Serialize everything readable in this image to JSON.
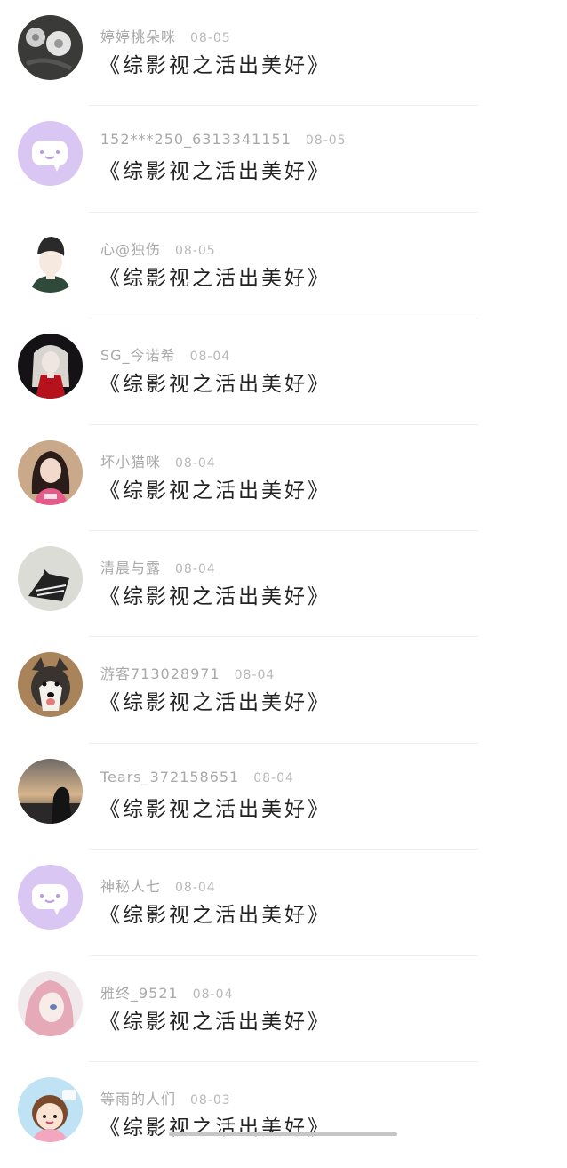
{
  "comments": [
    {
      "user": "婷婷桃朵咪",
      "date": "08-05",
      "text": "《综影视之活出美好》",
      "avatar": "flower-photo-avatar"
    },
    {
      "user": "152***250_6313341151",
      "date": "08-05",
      "text": "《综影视之活出美好》",
      "avatar": "default-chat-bubble-avatar"
    },
    {
      "user": "心@独伤",
      "date": "08-05",
      "text": "《综影视之活出美好》",
      "avatar": "anime-boy-avatar"
    },
    {
      "user": "SG_今诺希",
      "date": "08-04",
      "text": "《综影视之活出美好》",
      "avatar": "red-dress-doll-avatar"
    },
    {
      "user": "坏小猫咪",
      "date": "08-04",
      "text": "《综影视之活出美好》",
      "avatar": "girl-photo-avatar"
    },
    {
      "user": "清晨与露",
      "date": "08-04",
      "text": "《综影视之活出美好》",
      "avatar": "cat-photo-avatar"
    },
    {
      "user": "游客713028971",
      "date": "08-04",
      "text": "《综影视之活出美好》",
      "avatar": "husky-dog-avatar"
    },
    {
      "user": "Tears_372158651",
      "date": "08-04",
      "text": "《综影视之活出美好》",
      "avatar": "sunset-silhouette-avatar"
    },
    {
      "user": "神秘人七",
      "date": "08-04",
      "text": "《综影视之活出美好》",
      "avatar": "default-chat-bubble-avatar"
    },
    {
      "user": "雅终_9521",
      "date": "08-04",
      "text": "《综影视之活出美好》",
      "avatar": "anime-pink-hair-avatar"
    },
    {
      "user": "等雨的人们",
      "date": "08-03",
      "text": "《综影视之活出美好》",
      "avatar": "cartoon-kid-avatar"
    }
  ],
  "colors": {
    "username": "#a9a9a9",
    "date": "#b8b8b8",
    "text": "#222222",
    "default_avatar_bg": "#d9c6f3"
  }
}
